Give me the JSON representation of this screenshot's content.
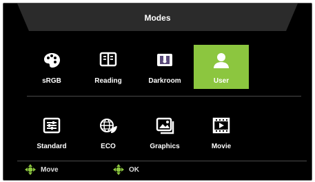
{
  "window": {
    "title": "Modes"
  },
  "modes_row1": [
    {
      "label": "sRGB",
      "icon": "palette-icon",
      "selected": false
    },
    {
      "label": "Reading",
      "icon": "book-icon",
      "selected": false
    },
    {
      "label": "Darkroom",
      "icon": "darkroom-icon",
      "selected": false
    },
    {
      "label": "User",
      "icon": "user-icon",
      "selected": true
    }
  ],
  "modes_row2": [
    {
      "label": "Standard",
      "icon": "sliders-icon",
      "selected": false
    },
    {
      "label": "ECO",
      "icon": "eco-globe-icon",
      "selected": false
    },
    {
      "label": "Graphics",
      "icon": "graphics-icon",
      "selected": false
    },
    {
      "label": "Movie",
      "icon": "film-icon",
      "selected": false
    }
  ],
  "footer": {
    "move_label": "Move",
    "ok_label": "OK"
  },
  "colors": {
    "accent": "#8cc63f",
    "background": "#000000",
    "text": "#ffffff"
  }
}
